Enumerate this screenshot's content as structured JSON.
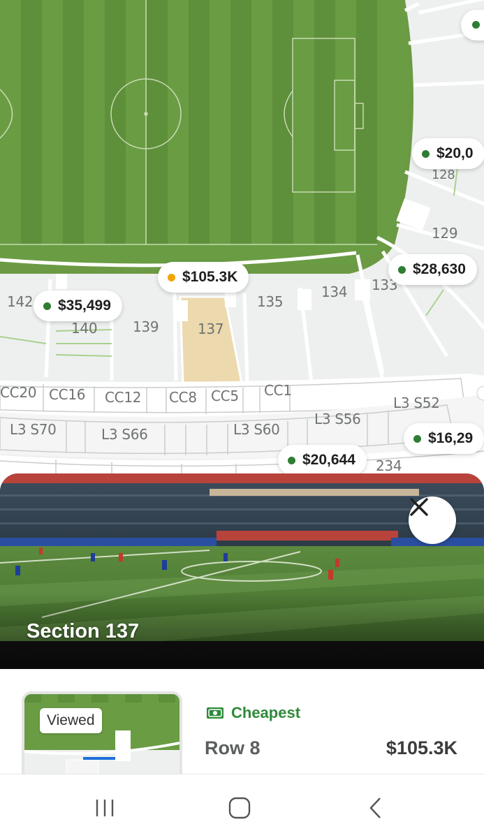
{
  "map": {
    "sections": [
      "142",
      "140",
      "139",
      "137",
      "135",
      "134",
      "133",
      "128",
      "129",
      "234"
    ],
    "club_labels": [
      "CC20",
      "CC16",
      "CC12",
      "CC8",
      "CC5",
      "CC1"
    ],
    "level3_labels": [
      "L3 S70",
      "L3 S66",
      "L3 S60",
      "L3 S56",
      "L3 S52"
    ],
    "price_pins": [
      {
        "label": "$105.3K",
        "dot_color": "#f0a500"
      },
      {
        "label": "$35,499",
        "dot_color": "#2f7d32"
      },
      {
        "label": "$28,630",
        "dot_color": "#2f7d32"
      },
      {
        "label": "$20,0",
        "dot_color": "#2f7d32"
      },
      {
        "label": "$16,29",
        "dot_color": "#2f7d32"
      },
      {
        "label": "$20,644",
        "dot_color": "#2f7d32"
      }
    ],
    "colors": {
      "pitch_dark": "#5c8e3c",
      "pitch_light": "#7aad4e",
      "selected_section": "#ecd9ae",
      "seat_bg": "#eef0ef",
      "pin_green": "#2f7d32"
    }
  },
  "preview": {
    "title": "Section 137",
    "close_icon": "close-icon"
  },
  "listing": {
    "viewed_badge": "Viewed",
    "cheapest_label": "Cheapest",
    "cheapest_icon": "cash-icon",
    "row": "Row 8",
    "price": "$105.3K"
  },
  "navbar": {
    "icons": [
      "recent-apps-icon",
      "home-icon",
      "back-icon"
    ]
  }
}
